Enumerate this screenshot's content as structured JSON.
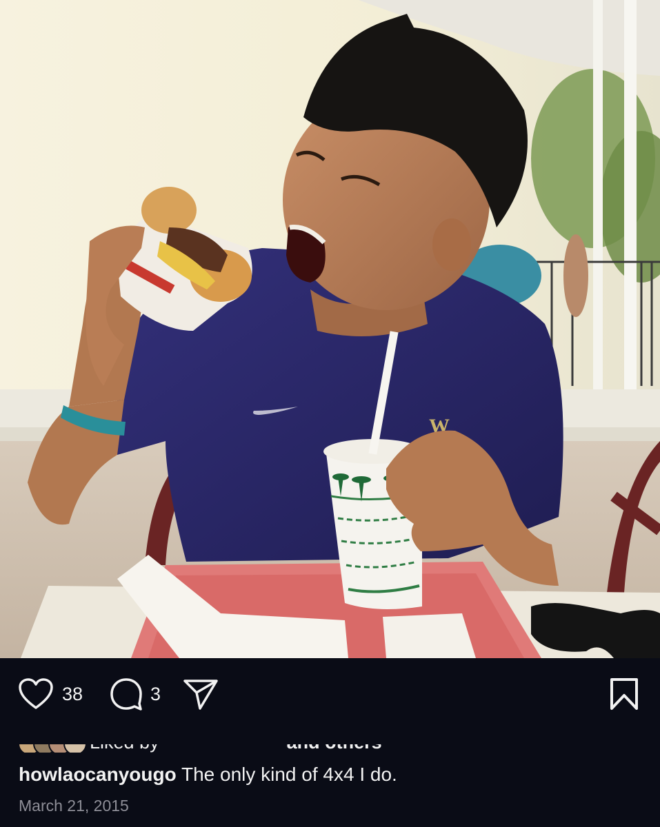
{
  "post": {
    "photo_alt": "",
    "likes_count": "38",
    "comments_count": "3",
    "liked_by_prefix": "Liked by",
    "liked_by_suffix": "and others",
    "username": "howlaocanyougo",
    "caption": "The only kind of 4x4 I do.",
    "date": "March 21, 2015"
  },
  "icons": {
    "like": "heart-icon",
    "comment": "comment-icon",
    "share": "send-icon",
    "save": "bookmark-icon"
  },
  "colors": {
    "background": "#0a0c16",
    "text": "#f2f2f2",
    "muted": "#8e8e97",
    "shirt": "#2b2a6a",
    "tray": "#e07a78"
  }
}
